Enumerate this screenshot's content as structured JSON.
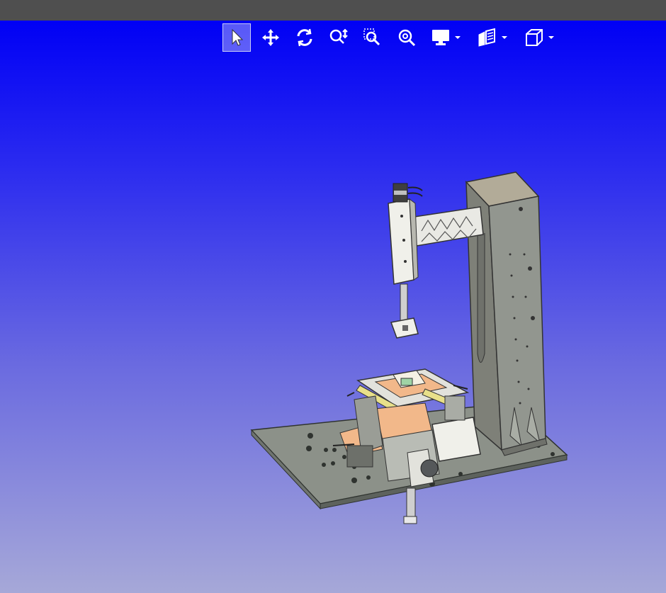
{
  "toolbar": {
    "tools": [
      {
        "icon": "select-arrow-icon",
        "active": true
      },
      {
        "icon": "pan-move-icon",
        "active": false
      },
      {
        "icon": "rotate-icon",
        "active": false
      },
      {
        "icon": "zoom-dynamic-icon",
        "active": false
      },
      {
        "icon": "zoom-window-icon",
        "active": false
      },
      {
        "icon": "zoom-fit-icon",
        "active": false
      },
      {
        "icon": "display-monitor-icon",
        "active": false,
        "dropdown": true
      },
      {
        "icon": "section-view-icon",
        "active": false,
        "dropdown": true
      },
      {
        "icon": "view-cube-icon",
        "active": false,
        "dropdown": true
      }
    ]
  },
  "colors": {
    "titlebar": "#4f4f4f",
    "viewport_top": "#0000f5",
    "viewport_bottom": "#a6a8d8",
    "model_gray": "#8a8f8a",
    "model_light": "#f0f0ea",
    "accent_yellow": "#e8e08a",
    "accent_orange": "#f2b88a"
  }
}
